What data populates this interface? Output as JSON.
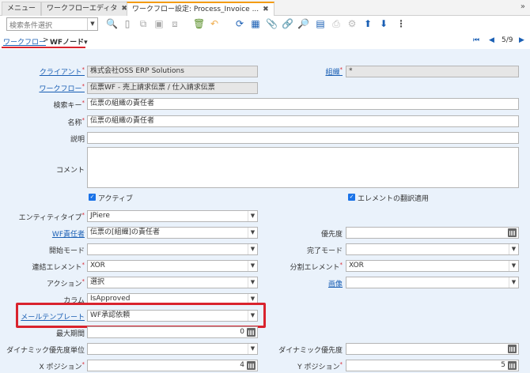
{
  "tabs": [
    {
      "label": "メニュー",
      "closable": false
    },
    {
      "label": "ワークフローエディタ",
      "closable": true
    },
    {
      "label": "ワークフロー設定: Process_Invoice ...",
      "closable": true,
      "active": true
    }
  ],
  "toolbar": {
    "search_placeholder": "検索条件選択",
    "icons": [
      "search-icon",
      "new-record-icon",
      "copy-icon",
      "save-icon",
      "save-new-icon",
      "delete-icon",
      "refresh-icon",
      "undo-icon",
      "grid-toggle-icon",
      "attachment-icon",
      "chat-icon",
      "zoom-across-icon",
      "report-icon",
      "print-icon",
      "settings-icon",
      "lock-icon",
      "parent-up-icon",
      "detail-down-icon",
      "more-icon"
    ]
  },
  "breadcrumb": {
    "link": "ワークフロー",
    "separator": ">",
    "current": "WFノード"
  },
  "navigation": {
    "record_index": "5/9"
  },
  "form": {
    "client_label": "クライアント",
    "client_value": "株式会社OSS ERP Solutions",
    "org_label": "組織",
    "org_value": "*",
    "workflow_label": "ワークフロー",
    "workflow_value": "伝票WF - 売上請求伝票 / 仕入請求伝票",
    "searchkey_label": "検索キー",
    "searchkey_value": "伝票の組織の責任者",
    "name_label": "名称",
    "name_value": "伝票の組織の責任者",
    "description_label": "説明",
    "description_value": "",
    "comment_label": "コメント",
    "comment_value": "",
    "active_label": "アクティブ",
    "translated_label": "エレメントの翻訳適用",
    "entitytype_label": "エンティティタイプ",
    "entitytype_value": "JPiere",
    "responsible_label": "WF責任者",
    "responsible_value": "伝票の[組織]の責任者",
    "priority_label": "優先度",
    "priority_value": "",
    "startmode_label": "開始モード",
    "startmode_value": "",
    "finishmode_label": "完了モード",
    "finishmode_value": "",
    "join_label": "連結エレメント",
    "join_value": "XOR",
    "split_label": "分割エレメント",
    "split_value": "XOR",
    "action_label": "アクション",
    "action_value": "選択",
    "image_label": "画像",
    "image_value": "",
    "column_label": "カラム",
    "column_value": "IsApproved",
    "mailtemplate_label": "メールテンプレート",
    "mailtemplate_value": "WF承認依頼",
    "maxduration_label": "最大期間",
    "maxduration_value": "0",
    "dynprio_unit_label": "ダイナミック優先度単位",
    "dynprio_unit_value": "",
    "dynprio_label": "ダイナミック優先度",
    "dynprio_value": "",
    "xpos_label": "X ポジション",
    "xpos_value": "4",
    "ypos_label": "Y ポジション",
    "ypos_value": "5"
  }
}
